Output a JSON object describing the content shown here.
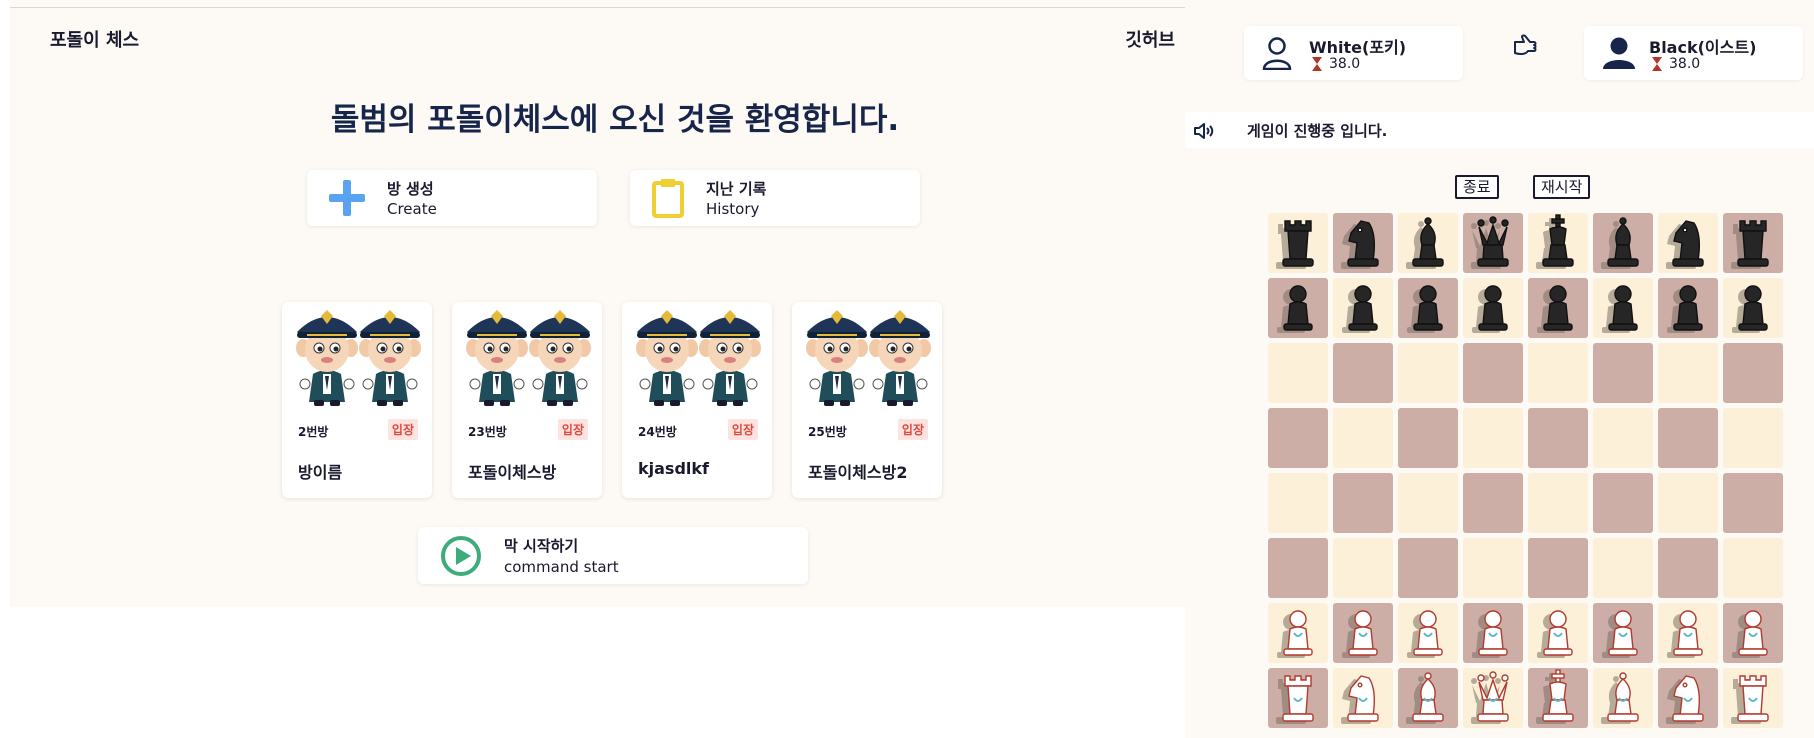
{
  "header": {
    "brand": "포돌이 체스",
    "github": "깃허브"
  },
  "welcome": "돌범의 포돌이체스에 오신 것을 환영합니다.",
  "menu": {
    "create": {
      "title": "방 생성",
      "subtitle": "Create",
      "icon": "plus-icon",
      "color": "#5aa3f0"
    },
    "history": {
      "title": "지난 기록",
      "subtitle": "History",
      "icon": "clipboard-icon",
      "color": "#f0cf33"
    },
    "start": {
      "title": "막 시작하기",
      "subtitle": "command start",
      "icon": "play-icon",
      "color": "#3dab7a"
    }
  },
  "rooms": [
    {
      "number": "2번방",
      "enter": "입장",
      "name": "방이름"
    },
    {
      "number": "23번방",
      "enter": "입장",
      "name": "포돌이체스방"
    },
    {
      "number": "24번방",
      "enter": "입장",
      "name": "kjasdlkf"
    },
    {
      "number": "25번방",
      "enter": "입장",
      "name": "포돌이체스방2"
    }
  ],
  "players": {
    "white": {
      "name": "White(포키)",
      "time": "38.0"
    },
    "black": {
      "name": "Black(이스트)",
      "time": "38.0"
    }
  },
  "status": {
    "message": "게임이 진행중 입니다."
  },
  "controls": {
    "end": "종료",
    "restart": "재시작"
  },
  "board": {
    "rows": [
      [
        "bR",
        "bN",
        "bB",
        "bQ",
        "bK",
        "bB",
        "bN",
        "bR"
      ],
      [
        "bP",
        "bP",
        "bP",
        "bP",
        "bP",
        "bP",
        "bP",
        "bP"
      ],
      [
        "",
        "",
        "",
        "",
        "",
        "",
        "",
        ""
      ],
      [
        "",
        "",
        "",
        "",
        "",
        "",
        "",
        ""
      ],
      [
        "",
        "",
        "",
        "",
        "",
        "",
        "",
        ""
      ],
      [
        "",
        "",
        "",
        "",
        "",
        "",
        "",
        ""
      ],
      [
        "wP",
        "wP",
        "wP",
        "wP",
        "wP",
        "wP",
        "wP",
        "wP"
      ],
      [
        "wR",
        "wN",
        "wB",
        "wQ",
        "wK",
        "wB",
        "wN",
        "wR"
      ]
    ],
    "light_color": "#fdf0d8",
    "dark_color": "#ccaea7"
  }
}
